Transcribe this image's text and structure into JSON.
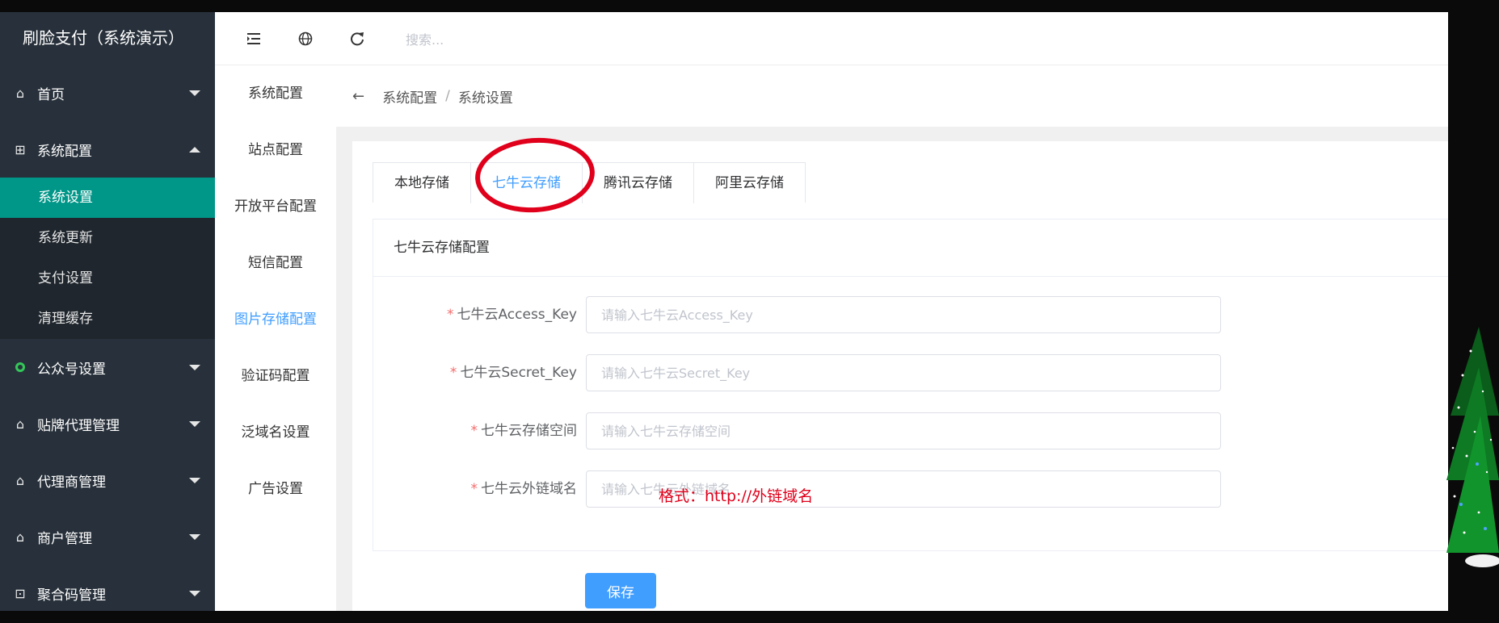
{
  "app_title": "刷脸支付（系统演示）",
  "sidebar": {
    "groups": [
      {
        "label": "首页",
        "icon": "home-icon"
      },
      {
        "label": "系统配置",
        "icon": "settings-icon",
        "expanded": true,
        "items": [
          {
            "label": "系统设置",
            "active": true
          },
          {
            "label": "系统更新"
          },
          {
            "label": "支付设置"
          },
          {
            "label": "清理缓存"
          }
        ]
      },
      {
        "label": "公众号设置",
        "icon": "wechat-icon"
      },
      {
        "label": "贴牌代理管理",
        "icon": "home-icon"
      },
      {
        "label": "代理商管理",
        "icon": "home-icon"
      },
      {
        "label": "商户管理",
        "icon": "home-icon"
      },
      {
        "label": "聚合码管理",
        "icon": "qrcode-icon"
      }
    ]
  },
  "topbar": {
    "menu_toggle_icon": "menu-fold-icon",
    "globe_icon": "globe-icon",
    "refresh_icon": "refresh-icon",
    "search_placeholder": "搜索..."
  },
  "submenu": {
    "items": [
      {
        "label": "系统配置"
      },
      {
        "label": "站点配置"
      },
      {
        "label": "开放平台配置"
      },
      {
        "label": "短信配置"
      },
      {
        "label": "图片存储配置",
        "active": true
      },
      {
        "label": "验证码配置"
      },
      {
        "label": "泛域名设置"
      },
      {
        "label": "广告设置"
      }
    ]
  },
  "breadcrumb": {
    "back_icon": "arrow-left-icon",
    "items": [
      "系统配置",
      "系统设置"
    ],
    "separator": "/"
  },
  "tabs": [
    {
      "label": "本地存储"
    },
    {
      "label": "七牛云存储",
      "active": true
    },
    {
      "label": "腾讯云存储"
    },
    {
      "label": "阿里云存储"
    }
  ],
  "card": {
    "title": "七牛云存储配置",
    "fields": [
      {
        "label": "七牛云Access_Key",
        "placeholder": "请输入七牛云Access_Key",
        "value": ""
      },
      {
        "label": "七牛云Secret_Key",
        "placeholder": "请输入七牛云Secret_Key",
        "value": ""
      },
      {
        "label": "七牛云存储空间",
        "placeholder": "请输入七牛云存储空间",
        "value": ""
      },
      {
        "label": "七牛云外链域名",
        "placeholder": "请输入七牛云外链域名",
        "value": ""
      }
    ]
  },
  "annotation": "格式：http://外链域名",
  "save_label": "保存",
  "colors": {
    "sidebar_bg": "#28313b",
    "active_green": "#009688",
    "primary_blue": "#409eff",
    "annotation_red": "#e0001b"
  }
}
